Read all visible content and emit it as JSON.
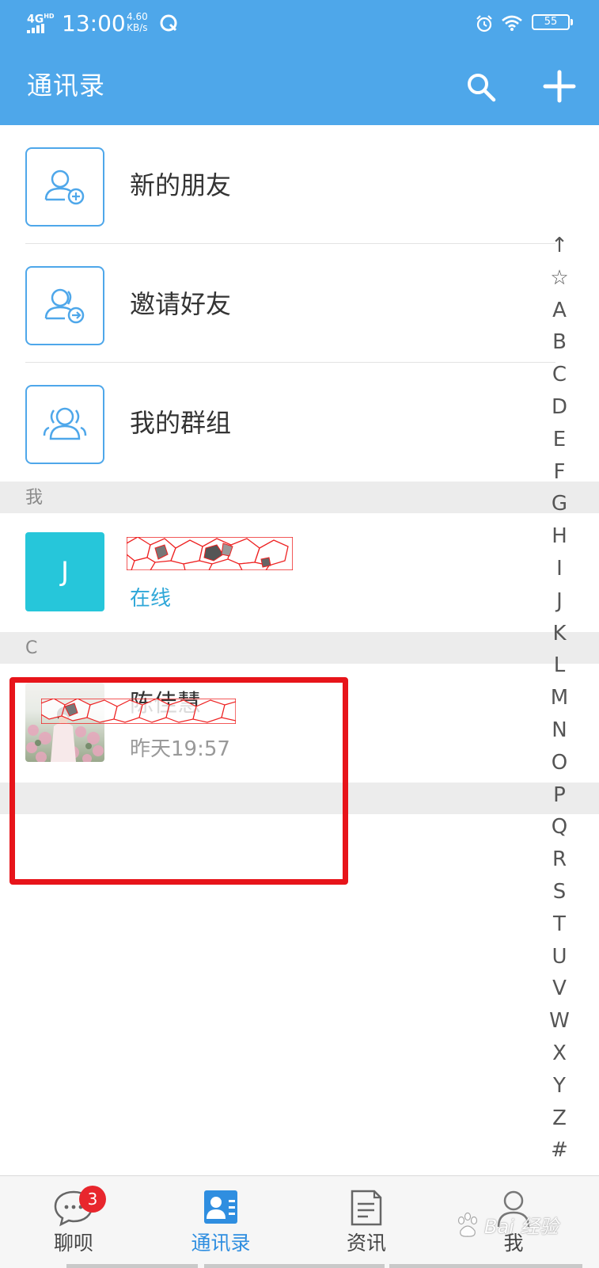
{
  "status_bar": {
    "network": "4G",
    "network_sup": "HD",
    "time": "13:00",
    "speed_value": "4.60",
    "speed_unit": "KB/s",
    "battery": "55"
  },
  "header": {
    "title": "通讯录",
    "search_icon": "search-icon",
    "add_icon": "plus-icon"
  },
  "features": [
    {
      "label": "新的朋友",
      "icon": "add-friend-icon"
    },
    {
      "label": "邀请好友",
      "icon": "invite-friend-icon"
    },
    {
      "label": "我的群组",
      "icon": "group-icon"
    }
  ],
  "sections": [
    {
      "header": "我",
      "contacts": [
        {
          "avatar_letter": "J",
          "name": "",
          "subtitle": "在线",
          "name_redacted": true
        }
      ]
    },
    {
      "header": "C",
      "contacts": [
        {
          "avatar_photo": true,
          "name": "陈佳慧",
          "subtitle": "昨天19:57",
          "name_redacted": true
        }
      ]
    }
  ],
  "alphabet_index": [
    "↑",
    "☆",
    "A",
    "B",
    "C",
    "D",
    "E",
    "F",
    "G",
    "H",
    "I",
    "J",
    "K",
    "L",
    "M",
    "N",
    "O",
    "P",
    "Q",
    "R",
    "S",
    "T",
    "U",
    "V",
    "W",
    "X",
    "Y",
    "Z",
    "#"
  ],
  "bottom_nav": [
    {
      "label": "聊呗",
      "icon": "chat-bubble-icon",
      "badge": "3",
      "active": false
    },
    {
      "label": "通讯录",
      "icon": "contacts-icon",
      "active": true
    },
    {
      "label": "资讯",
      "icon": "news-icon",
      "active": false
    },
    {
      "label": "我",
      "icon": "profile-icon",
      "active": false
    }
  ],
  "watermark": {
    "text": "Bai 经验",
    "subtext": "jingyan.baidu.com"
  },
  "colors": {
    "header_bg": "#4ea7ea",
    "accent": "#2f8ee0",
    "online": "#2fa7d8",
    "avatar_bg": "#26c6da",
    "badge": "#e8262d",
    "highlight": "#e7141a"
  }
}
